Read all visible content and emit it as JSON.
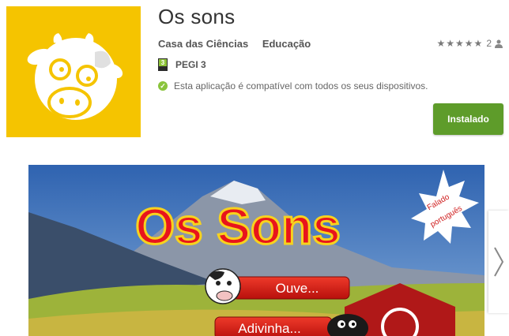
{
  "app": {
    "title": "Os sons",
    "developer": "Casa das Ciências",
    "category": "Educação",
    "rating_count": "2",
    "pegi_label": "PEGI 3",
    "pegi_number": "3",
    "compat_text": "Esta aplicação é compatível com todos os seus dispositivos.",
    "install_label": "Instalado",
    "stars": "★★★★★"
  },
  "screenshot": {
    "game_title": "Os Sons",
    "badge_text_1": "Falado",
    "badge_text_2": "português",
    "btn_listen": "Ouve...",
    "btn_guess": "Adivinha..."
  },
  "icons": [
    "cow-icon",
    "star-icon",
    "person-icon",
    "check-icon",
    "chevron-right-icon"
  ],
  "colors": {
    "icon_bg": "#f5c400",
    "install": "#5e9c2a",
    "pegi_green": "#8fc43a",
    "title_red": "#e8141c",
    "title_yellow": "#f7d21e",
    "sky": "#3c6fb8",
    "grass": "#9db33a"
  }
}
